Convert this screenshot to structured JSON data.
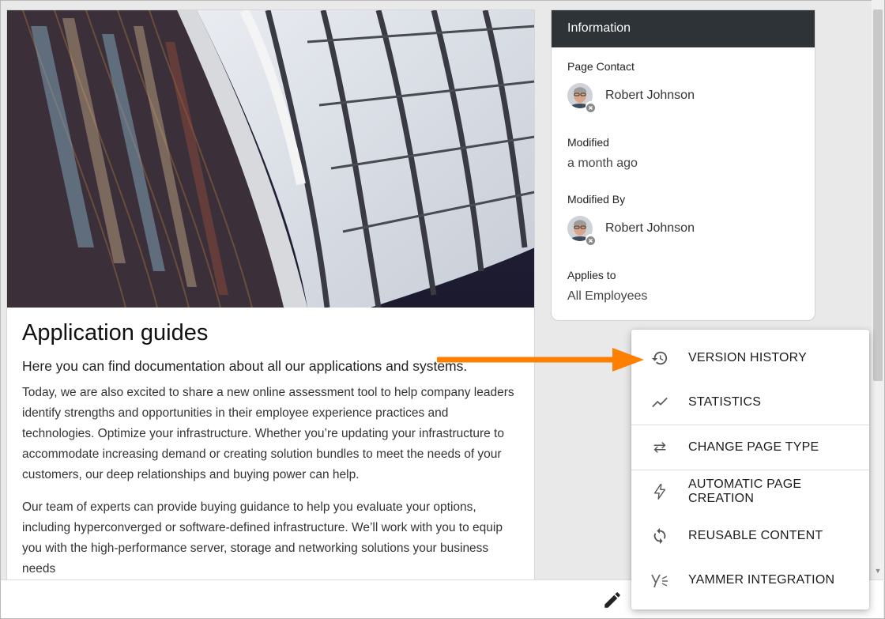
{
  "article": {
    "title": "Application guides",
    "lead": "Here you can find documentation about all our applications and systems.",
    "paragraphs": [
      "Today, we are also excited to share a new online assessment tool to help company leaders identify strengths and opportunities in their employee experience practices and technologies. Optimize your infrastructure. Whether you’re updating your infrastructure to accommodate increasing demand or creating solution bundles to meet the needs of your customers, our deep relationships and buying power can help.",
      "Our team of experts can provide buying guidance to help you evaluate your options, including hyperconverged or software-defined infrastructure. We’ll work with you to equip you with the high-performance server, storage and networking solutions your business needs"
    ]
  },
  "info": {
    "header": "Information",
    "page_contact_label": "Page Contact",
    "page_contact_name": "Robert Johnson",
    "modified_label": "Modified",
    "modified_value": "a month ago",
    "modified_by_label": "Modified By",
    "modified_by_name": "Robert Johnson",
    "applies_to_label": "Applies to",
    "applies_to_value": "All Employees"
  },
  "menu": {
    "items": [
      {
        "label": "VERSION HISTORY",
        "icon": "history-icon"
      },
      {
        "label": "STATISTICS",
        "icon": "trend-line-icon"
      },
      {
        "label": "CHANGE PAGE TYPE",
        "icon": "swap-arrows-icon"
      },
      {
        "label": "AUTOMATIC PAGE CREATION",
        "icon": "lightning-bolt-icon"
      },
      {
        "label": "REUSABLE CONTENT",
        "icon": "sync-icon"
      },
      {
        "label": "YAMMER INTEGRATION",
        "icon": "yammer-icon"
      }
    ]
  },
  "colors": {
    "info_header_bg": "#2d3337",
    "annotation_arrow": "#ff7f00",
    "menu_text": "#1c1c1c"
  }
}
